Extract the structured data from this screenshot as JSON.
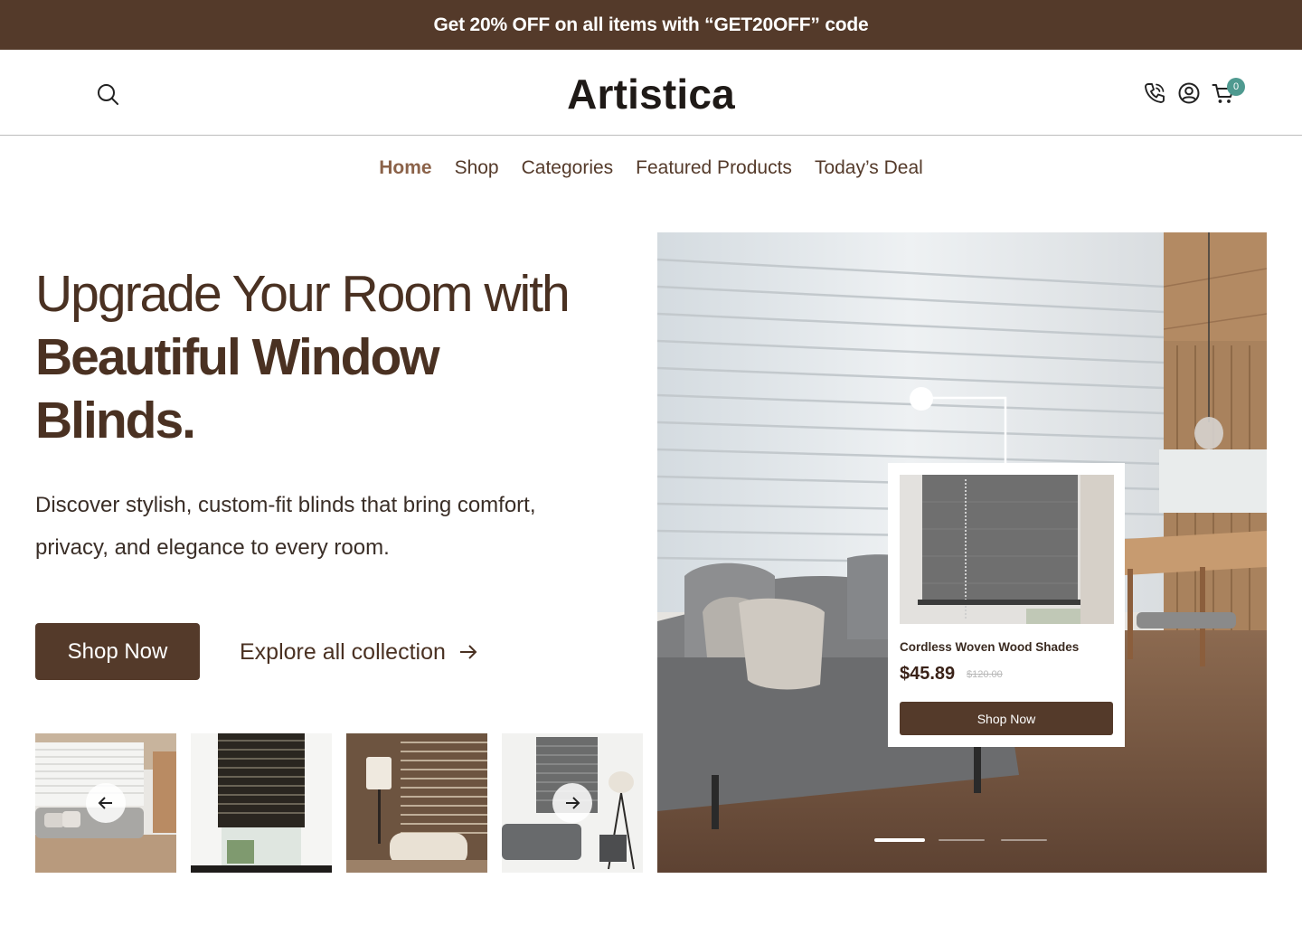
{
  "promo": {
    "text": "Get 20% OFF on all items with “GET20OFF” code"
  },
  "header": {
    "logo": "Artistica",
    "cart_count": "0",
    "icons": [
      "search-icon",
      "phone-icon",
      "user-icon",
      "cart-icon"
    ]
  },
  "nav": {
    "items": [
      {
        "label": "Home",
        "active": true
      },
      {
        "label": "Shop"
      },
      {
        "label": "Categories"
      },
      {
        "label": "Featured Products"
      },
      {
        "label": "Today’s Deal"
      }
    ]
  },
  "hero": {
    "title_line1": "Upgrade Your Room with",
    "title_line2": "Beautiful Window",
    "title_line3": "Blinds.",
    "description": "Discover stylish, custom-fit blinds that bring comfort, privacy, and elegance to every room.",
    "primary_button": "Shop Now",
    "secondary_link": "Explore all collection"
  },
  "thumbnails": {
    "count": 4,
    "prev_icon": "arrow-left-icon",
    "next_icon": "arrow-right-icon"
  },
  "product_card": {
    "name": "Cordless Woven Wood Shades",
    "price": "$45.89",
    "old_price": "$120.00",
    "button": "Shop Now"
  },
  "slider": {
    "total": 3,
    "active_index": 0
  },
  "colors": {
    "brand_brown": "#543a2a",
    "accent_brown": "#8b6249",
    "badge_teal": "#4f9a90"
  }
}
